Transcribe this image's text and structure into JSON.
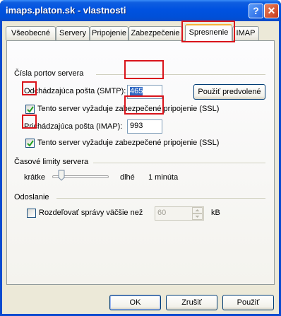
{
  "window": {
    "title": "imaps.platon.sk - vlastnosti",
    "help_glyph": "?",
    "close_glyph": "✕"
  },
  "tabs": [
    {
      "label": "Všeobecné",
      "active": false
    },
    {
      "label": "Servery",
      "active": false
    },
    {
      "label": "Pripojenie",
      "active": false
    },
    {
      "label": "Zabezpečenie",
      "active": false
    },
    {
      "label": "Spresnenie",
      "active": true
    },
    {
      "label": "IMAP",
      "active": false
    }
  ],
  "ports": {
    "group_title": "Čísla portov servera",
    "smtp_label": "Odchádzajúca pošta (SMTP):",
    "smtp_value": "465",
    "default_button": "Použiť predvolené",
    "smtp_ssl_label": "Tento server vyžaduje zabezpečené pripojenie (SSL)",
    "smtp_ssl_checked": true,
    "imap_label": "Prichádzajúca pošta (IMAP):",
    "imap_value": "993",
    "imap_ssl_label": "Tento server vyžaduje zabezpečené pripojenie (SSL)",
    "imap_ssl_checked": true
  },
  "timeouts": {
    "group_title": "Časové limity servera",
    "short_label": "krátke",
    "long_label": "dlhé",
    "value_text": "1 minúta",
    "slider_level": 0.05
  },
  "sending": {
    "group_title": "Odoslanie",
    "split_label": "Rozdeľovať správy väčšie než",
    "split_checked": false,
    "split_value": "60",
    "unit": "kB"
  },
  "buttons": {
    "ok": "OK",
    "cancel": "Zrušiť",
    "apply": "Použiť"
  },
  "colors": {
    "highlight": "#d9141b",
    "title_bar": "#0052e0",
    "active_tab_accent": "#f8b33a"
  }
}
